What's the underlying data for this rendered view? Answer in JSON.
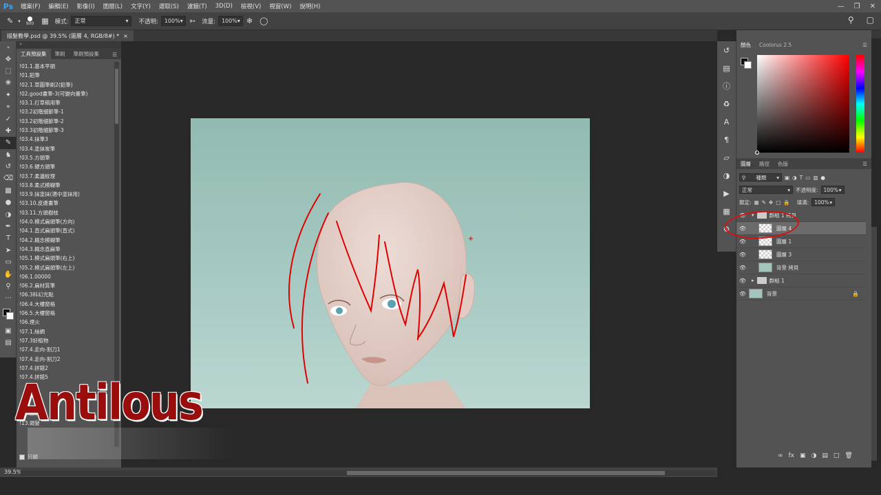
{
  "app": {
    "logo": "Ps"
  },
  "menu": [
    "檔案(F)",
    "編輯(E)",
    "影像(I)",
    "圖層(L)",
    "文字(Y)",
    "選取(S)",
    "濾鏡(T)",
    "3D(D)",
    "檢視(V)",
    "視窗(W)",
    "說明(H)"
  ],
  "options": {
    "brush_size": "900",
    "mode_label": "模式:",
    "mode_value": "正常",
    "opacity_label": "不透明:",
    "opacity_value": "100%",
    "flow_label": "流量:",
    "flow_value": "100%"
  },
  "document": {
    "tab_title": "描髮教學.psd @ 39.5% (圖層 4, RGB/8#) *",
    "close": "×"
  },
  "brush_panel": {
    "tabs": [
      "工具預設集",
      "筆刷",
      "筆刷預設集"
    ],
    "items": [
      "!01.1.基本平頭",
      "!01.鉛筆",
      "!02.1.草圖筆刷2(鉛筆)",
      "!02.good畫筆-3(可變向量筆)",
      "!03.1.打草稿用筆",
      "!03.2初階細節筆-1",
      "!03.2初階細節筆-2",
      "!03.3初階細節筆-3",
      "!03.4.抹筆3",
      "!03.4.塗抹炭筆",
      "!03.5.方頭筆",
      "!03.6.硬方頭筆",
      "!03.7.柔邊紋理",
      "!03.8.柔式模糊筆",
      "!03.9.抹塗抹(適中塗抹用)",
      "!03.10.皮膚畫筆",
      "!03.11.方頭樹枝",
      "!04.0.模式扁頭筆(方向)",
      "!04.1.直式扁頭筆(直式)",
      "!04.2.概念模糊筆",
      "!04.3.概念直扁筆",
      "!05.1.模式扁頭筆(右上)",
      "!05.2.模式扁頭筆(左上)",
      "!06.1.00000",
      "!06.2.扁材質筆",
      "!06.3科幻光點",
      "!06.4.大樓窗格",
      "!06.5.大樓窗格",
      "!06.煙火",
      "!07.1.絲綢",
      "!07.3好植物",
      "!07.4.走向-割刀1",
      "!07.4.走向-割刀2",
      "!07.4.拼錯2",
      "!07.4.拼錯5",
      "",
      "",
      "",
      "!12.紋理",
      "!13.頭髮"
    ],
    "footer_label": "只顯"
  },
  "watermark": {
    "text": "Antilous"
  },
  "status": {
    "zoom": "39.5%"
  },
  "right_panel": {
    "color_tabs": [
      "顏色",
      "Coolorus 2.5"
    ],
    "layer_tabs": [
      "圖層",
      "路徑",
      "色版"
    ],
    "filter_label": "種類",
    "blend_mode": "正常",
    "opacity_label": "不透明度:",
    "opacity_value": "100%",
    "lock_label": "鎖定:",
    "fill_label": "填滿:",
    "fill_value": "100%",
    "layers": [
      {
        "name": "群組 1 拷貝",
        "kind": "group"
      },
      {
        "name": "圖層 4",
        "kind": "layer",
        "selected": true
      },
      {
        "name": "圖層 1",
        "kind": "layer"
      },
      {
        "name": "圖層 3",
        "kind": "layer"
      },
      {
        "name": "背景 拷貝",
        "kind": "bg"
      },
      {
        "name": "群組 1",
        "kind": "group"
      },
      {
        "name": "背景",
        "kind": "bg",
        "locked": true
      }
    ]
  },
  "colors": {
    "accent_red": "#d91010",
    "canvas_teal": "#a2c6bd",
    "panel": "#535353"
  }
}
